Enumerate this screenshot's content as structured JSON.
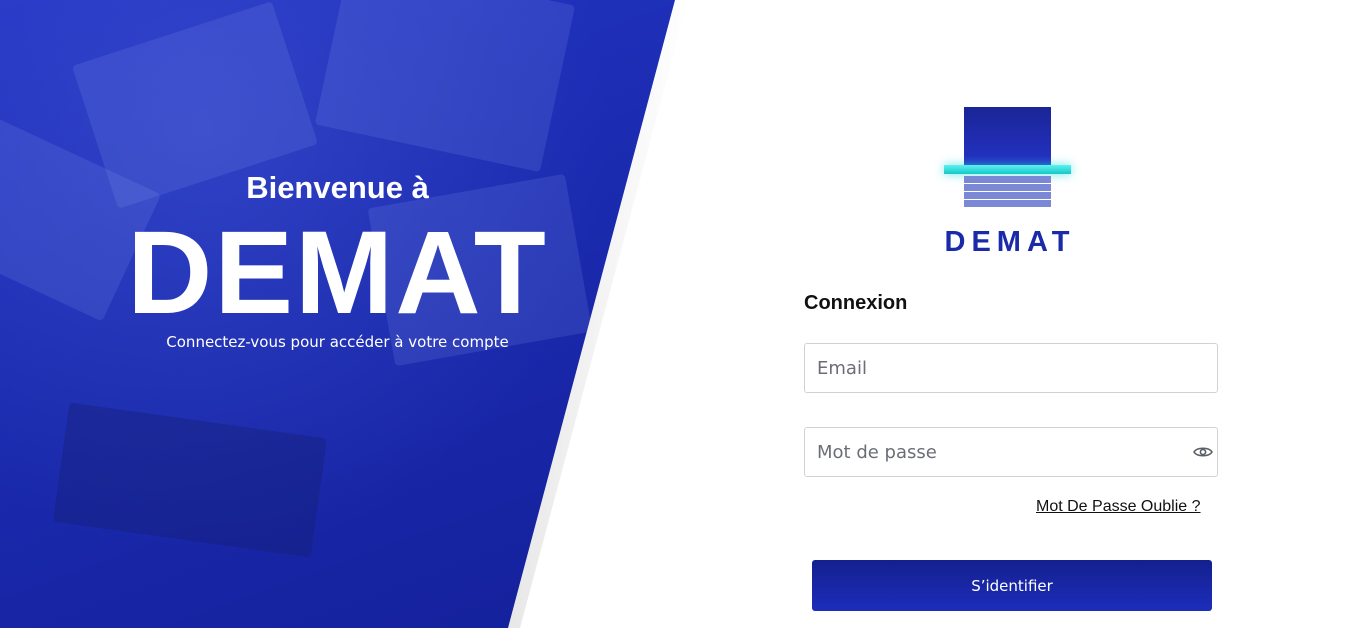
{
  "hero": {
    "welcome": "Bienvenue à",
    "title": "DEMAT",
    "subtitle": "Connectez-vous pour accéder à votre compte"
  },
  "logo": {
    "brand": "DEMAT",
    "colors": {
      "primary": "#1a2aa8",
      "accent": "#14c8c8"
    }
  },
  "login": {
    "heading": "Connexion",
    "email_placeholder": "Email",
    "email_value": "",
    "password_placeholder": "Mot de passe",
    "password_value": "",
    "password_toggle_icon": "eye-icon",
    "forgot_label": "Mot De Passe Oublie ?",
    "submit_label": "S’identifier"
  }
}
